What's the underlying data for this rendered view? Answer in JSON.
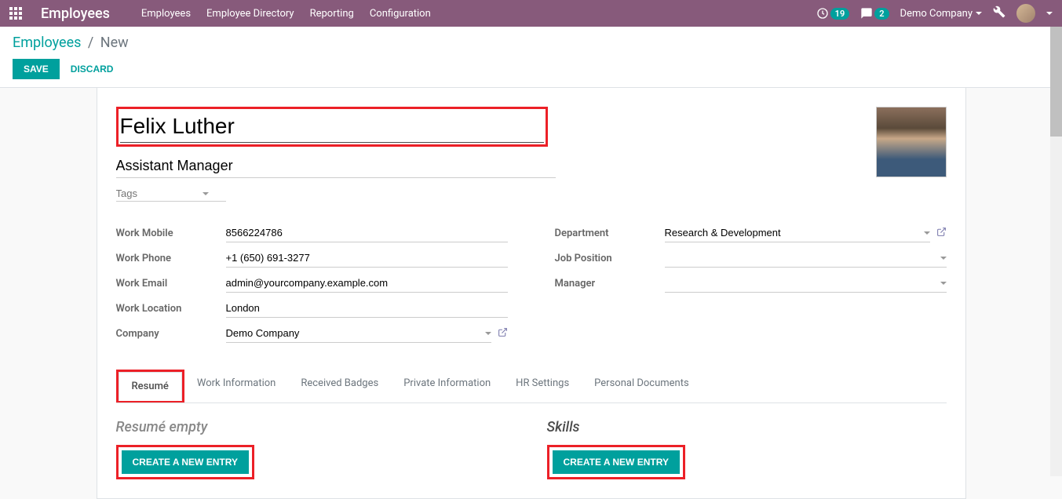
{
  "navbar": {
    "brand": "Employees",
    "menu": [
      "Employees",
      "Employee Directory",
      "Reporting",
      "Configuration"
    ],
    "activity_count": "19",
    "messages_count": "2",
    "company": "Demo Company"
  },
  "breadcrumb": {
    "root": "Employees",
    "current": "New"
  },
  "buttons": {
    "save": "SAVE",
    "discard": "DISCARD"
  },
  "form": {
    "name": "Felix Luther",
    "job_title": "Assistant Manager",
    "tags_placeholder": "Tags",
    "left_fields": {
      "work_mobile": {
        "label": "Work Mobile",
        "value": "8566224786"
      },
      "work_phone": {
        "label": "Work Phone",
        "value": "+1 (650) 691-3277"
      },
      "work_email": {
        "label": "Work Email",
        "value": "admin@yourcompany.example.com"
      },
      "work_location": {
        "label": "Work Location",
        "value": "London"
      },
      "company": {
        "label": "Company",
        "value": "Demo Company"
      }
    },
    "right_fields": {
      "department": {
        "label": "Department",
        "value": "Research & Development"
      },
      "job_position": {
        "label": "Job Position",
        "value": ""
      },
      "manager": {
        "label": "Manager",
        "value": ""
      }
    }
  },
  "tabs": [
    "Resumé",
    "Work Information",
    "Received Badges",
    "Private Information",
    "HR Settings",
    "Personal Documents"
  ],
  "tab_content": {
    "resume_title": "Resumé empty",
    "skills_title": "Skills",
    "create_entry": "CREATE A NEW ENTRY"
  }
}
